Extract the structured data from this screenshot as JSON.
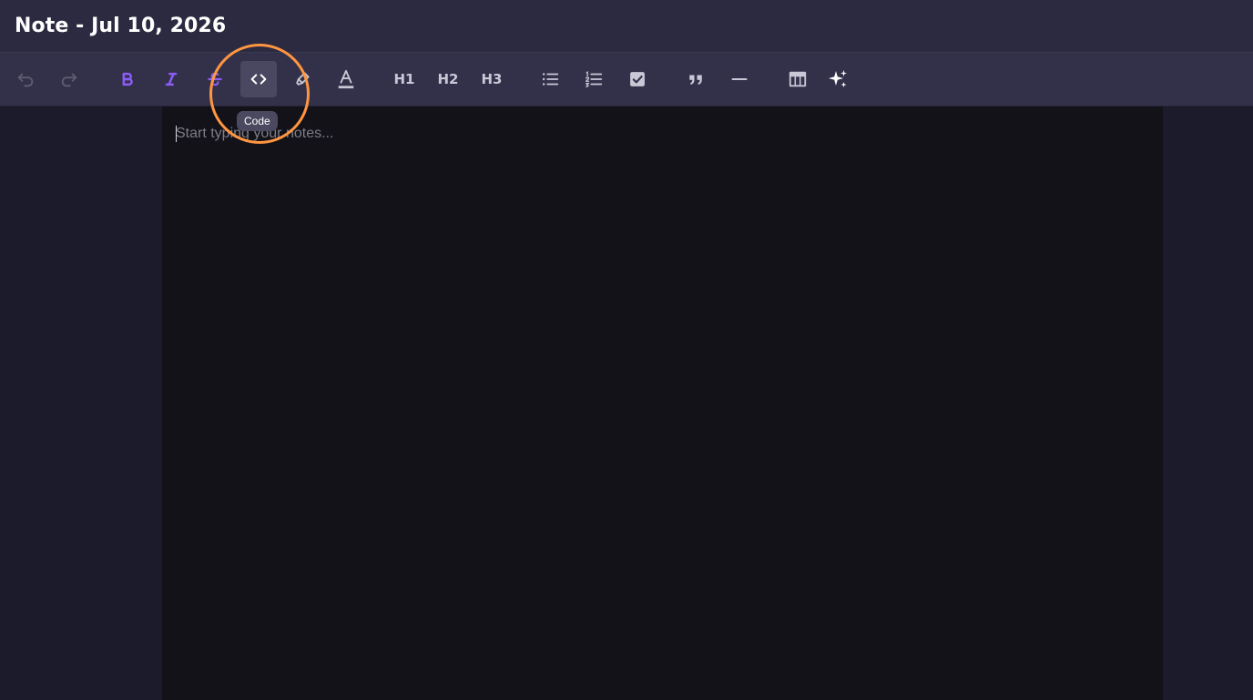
{
  "window": {
    "title": "Note - Jul 10, 2026"
  },
  "toolbar": {
    "heading1_label": "H1",
    "heading2_label": "H2",
    "heading3_label": "H3",
    "tooltip": "Code",
    "icons": {
      "undo": "undo-icon",
      "redo": "redo-icon",
      "bold": "bold-icon",
      "italic": "italic-icon",
      "strike": "strikethrough-icon",
      "code": "code-icon",
      "highlight": "highlighter-icon",
      "text_color": "text-color-icon",
      "bullet_list": "bullet-list-icon",
      "ordered_list": "ordered-list-icon",
      "task_list": "checkbox-icon",
      "quote": "quote-icon",
      "horizontal_rule": "horizontal-rule-icon",
      "table": "table-icon",
      "ai": "sparkles-icon"
    }
  },
  "editor": {
    "placeholder": "Start typing your notes..."
  },
  "colors": {
    "accent_purple": "#8b5cf6",
    "highlight_ring": "#ff9640",
    "background": "#1c1b2b",
    "editor_bg": "#131219",
    "toolbar_bg": "#33314a",
    "titlebar_bg": "#2c2a40"
  }
}
